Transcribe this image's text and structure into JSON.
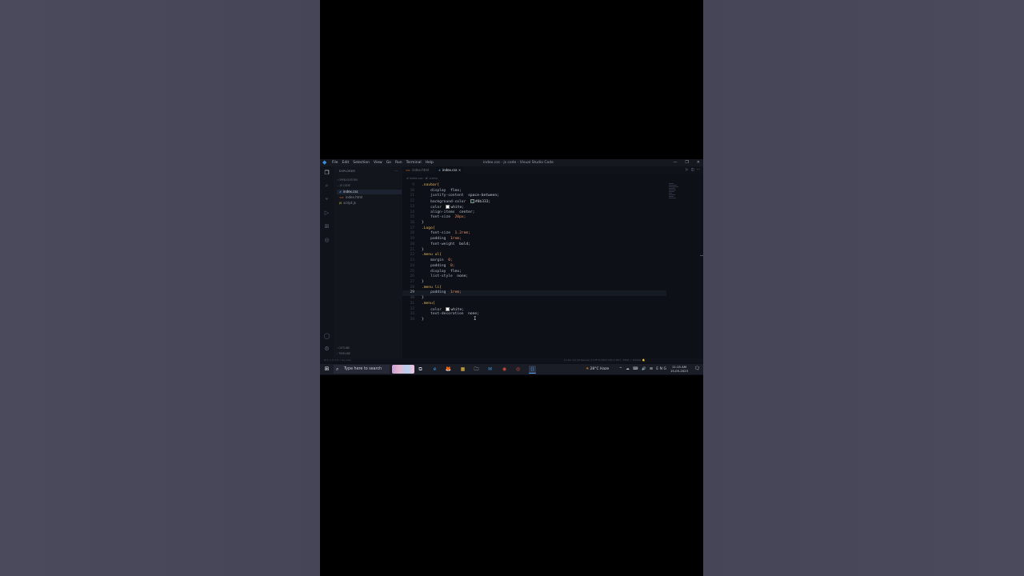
{
  "window": {
    "title": "index.css - js code - Visual Studio Code",
    "menu": [
      "File",
      "Edit",
      "Selection",
      "View",
      "Go",
      "Run",
      "Terminal",
      "Help"
    ],
    "controls": [
      "—",
      "❐",
      "✕"
    ]
  },
  "sidebar": {
    "title": "EXPLORER",
    "more": "···",
    "sections": [
      "OPEN EDITORS",
      "JS CODE"
    ],
    "files": [
      {
        "name": "index.css",
        "icon": "#",
        "selected": true
      },
      {
        "name": "index.html",
        "icon": "<>",
        "selected": false
      },
      {
        "name": "script.js",
        "icon": "JS",
        "selected": false
      }
    ],
    "bottom_sections": [
      "OUTLINE",
      "TIMELINE"
    ]
  },
  "tabs": [
    {
      "label": "index.html",
      "icon": "<>",
      "active": false
    },
    {
      "label": "index.css",
      "icon": "#",
      "active": true,
      "close": "×"
    }
  ],
  "tab_actions": [
    "▷",
    "◫",
    "···"
  ],
  "breadcrumb": "# index.css › ✿ .menu",
  "editor": {
    "cursor_line": 29,
    "lines": [
      {
        "n": "9",
        "text": ".navbar{"
      },
      {
        "n": "10",
        "text": "    display: flex;"
      },
      {
        "n": "11",
        "text": "    justify-content: space-between;"
      },
      {
        "n": "12",
        "text": "    background-color: #0b333;",
        "swatch": "#0b3330"
      },
      {
        "n": "13",
        "text": "    color: white;",
        "swatch": "#ffffff"
      },
      {
        "n": "14",
        "text": "    align-items: center;"
      },
      {
        "n": "15",
        "text": "    font-size: 20px;"
      },
      {
        "n": "16",
        "text": "}"
      },
      {
        "n": "17",
        "text": ".Logo{"
      },
      {
        "n": "18",
        "text": "    font-size: 1.2rem;"
      },
      {
        "n": "19",
        "text": "    padding: 1rem;"
      },
      {
        "n": "20",
        "text": "    font-weight: bold;"
      },
      {
        "n": "21",
        "text": "}"
      },
      {
        "n": "22",
        "text": ".menu ul{"
      },
      {
        "n": "23",
        "text": "    margin: 0;"
      },
      {
        "n": "24",
        "text": "    padding: 0;"
      },
      {
        "n": "25",
        "text": "    display: flex;"
      },
      {
        "n": "26",
        "text": "    list-style: none;"
      },
      {
        "n": "27",
        "text": "}"
      },
      {
        "n": "28",
        "text": ".menu li{"
      },
      {
        "n": "29",
        "text": "    padding: 1rem;"
      },
      {
        "n": "30",
        "text": "}"
      },
      {
        "n": "31",
        "text": ".menu{"
      },
      {
        "n": "32",
        "text": "    color: white;",
        "swatch": "#ffffff"
      },
      {
        "n": "33",
        "text": "    text-decoration: none;"
      },
      {
        "n": "34",
        "text": "}"
      }
    ]
  },
  "status": {
    "left": "⊗ 0  ⚠ 0    ⊙ 0  ⚡ Go Live",
    "right": "Ln 29, Col 18   Spaces: 4   UTF-8   CRLF   CSS   ⊙ Port : 5500   ✓ Prettier   🔔"
  },
  "taskbar": {
    "search_placeholder": "Type here to search",
    "apps": [
      "⧉",
      "e",
      "🦊",
      "▦",
      "🗀",
      "✉",
      "◉",
      "◎",
      "⟨⟩"
    ],
    "weather": "28°C  Haze",
    "tray": "^ ☁ ⌨ 🔊 ⊞ ENG",
    "time": "11:15 AM",
    "date": "15-05-2023",
    "notification_icon": "🗨"
  }
}
